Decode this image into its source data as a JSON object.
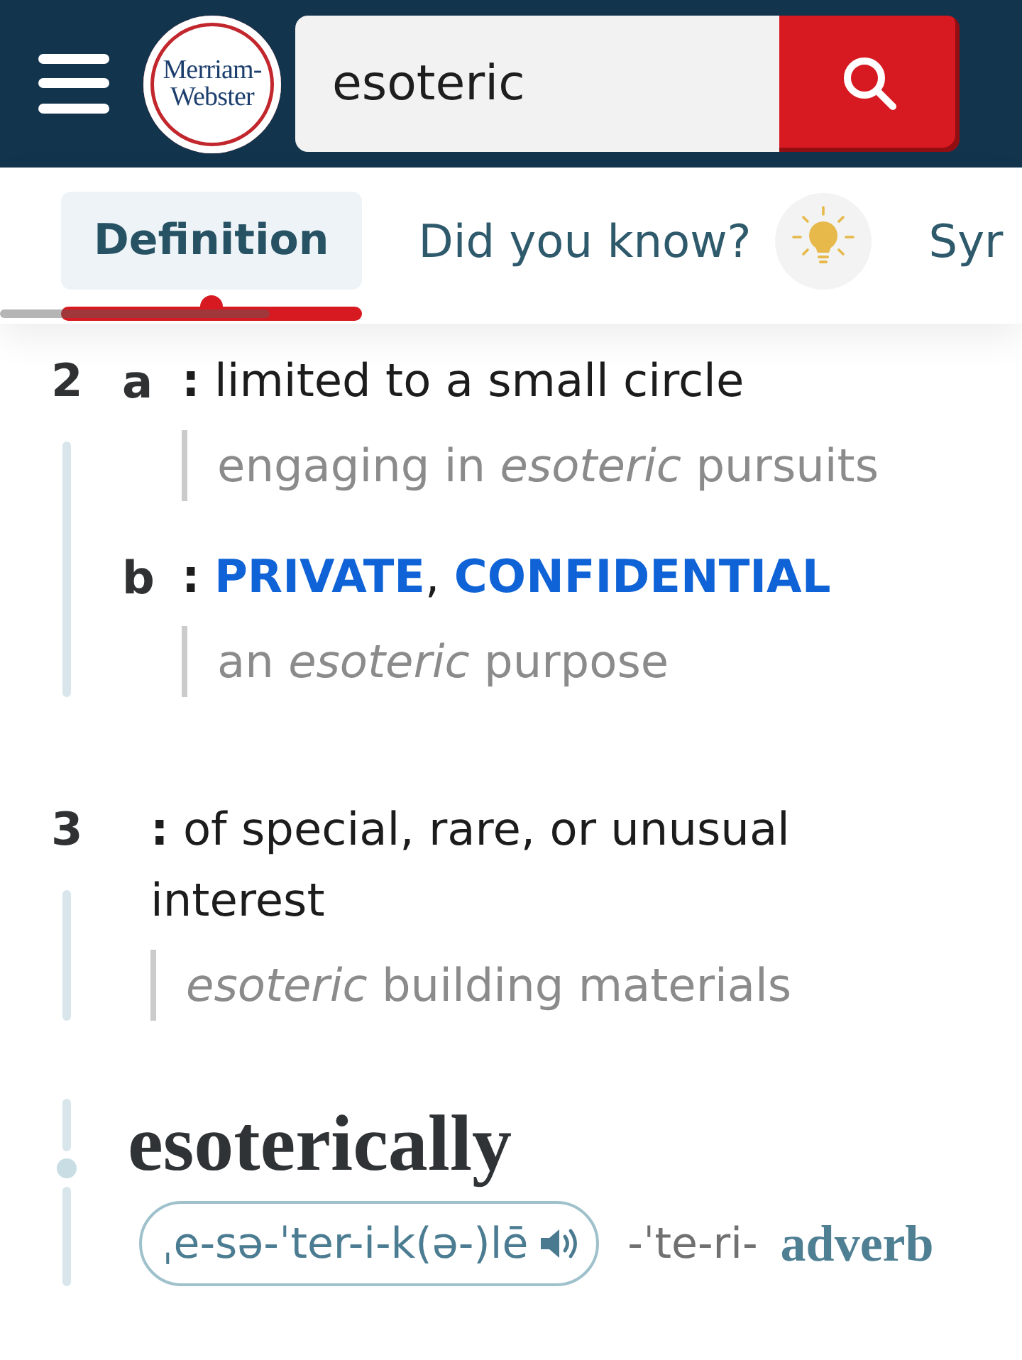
{
  "header": {
    "logo": {
      "lines": [
        "Merriam-",
        "Webster"
      ]
    },
    "search": {
      "value": "esoteric"
    }
  },
  "tabs": [
    {
      "label": "Definition",
      "selected": true,
      "kind": "text"
    },
    {
      "label": "Did you know?",
      "selected": false,
      "kind": "bulb"
    },
    {
      "label": "Syr",
      "selected": false,
      "kind": "text"
    }
  ],
  "senses": [
    {
      "number": "2",
      "subsenses": [
        {
          "letter": "a",
          "definition": [
            {
              "kind": "text",
              "text": "**:** limited to a small circle"
            }
          ],
          "example": "engaging in *esoteric* pursuits"
        },
        {
          "letter": "b",
          "definition": [
            {
              "kind": "text",
              "text": "**:** "
            },
            {
              "kind": "link",
              "text": "PRIVATE"
            },
            {
              "kind": "text",
              "text": ", "
            },
            {
              "kind": "link",
              "text": "CONFIDENTIAL"
            }
          ],
          "example": "an *esoteric* purpose"
        }
      ]
    },
    {
      "number": "3",
      "subsenses": [
        {
          "definition": [
            {
              "kind": "text",
              "text": "**:** of special, rare, or unusual interest"
            }
          ],
          "example": "*esoteric* building materials"
        }
      ]
    }
  ],
  "run_on": {
    "word": "esoterically",
    "pronunciation": "ˌe-sə-ˈter-i-k(ə-)lē",
    "variant": "-ˈte-ri-",
    "part_of_speech": "adverb"
  }
}
